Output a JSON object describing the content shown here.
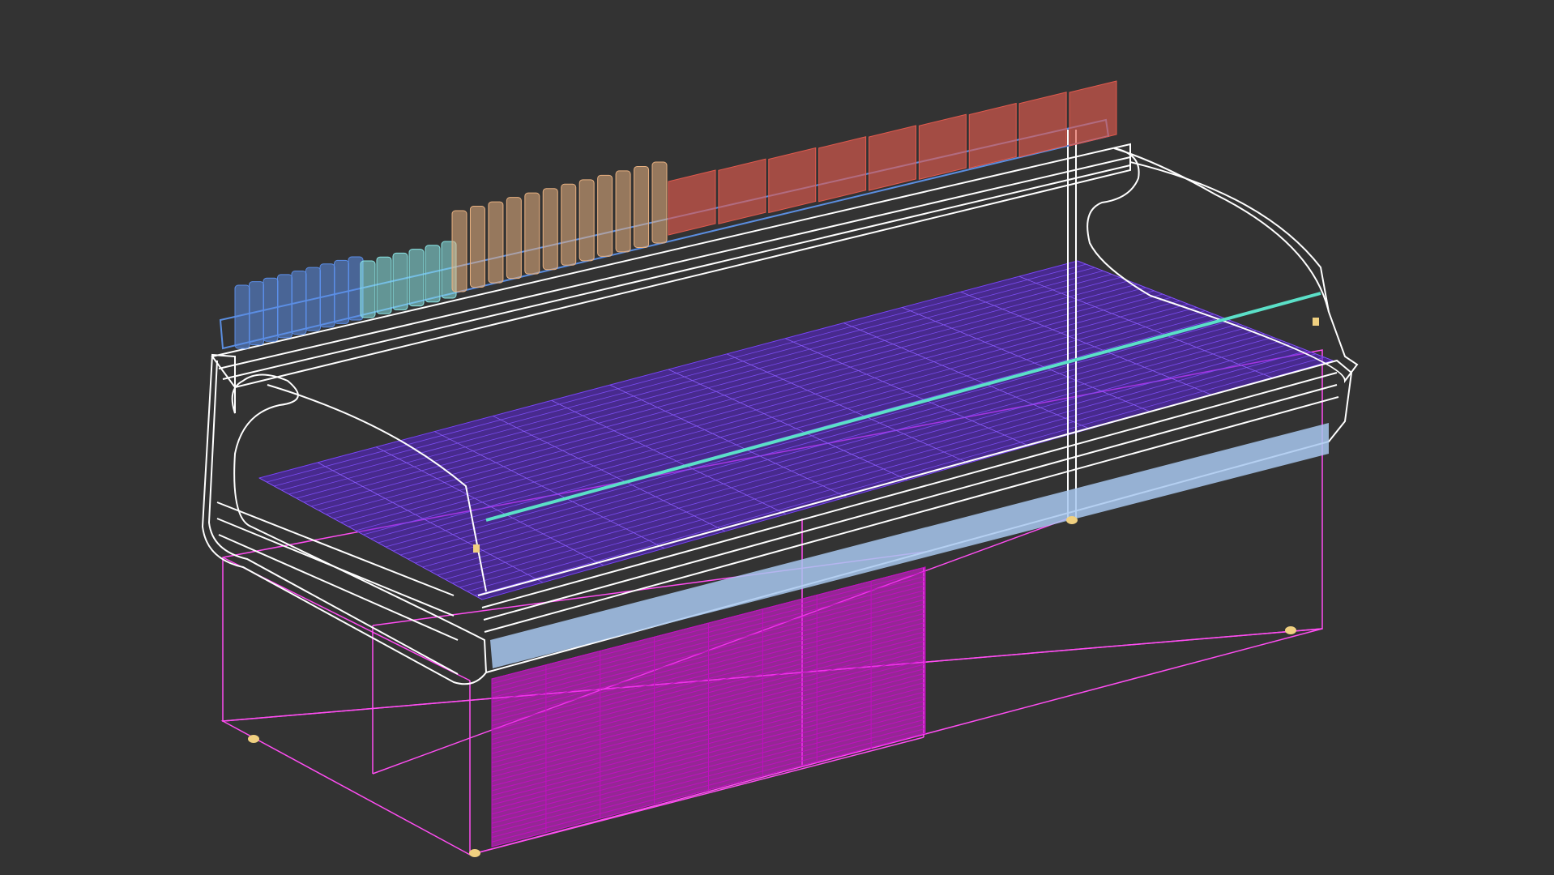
{
  "viewport": {
    "background": "#333333",
    "view_type": "wireframe perspective"
  },
  "model": {
    "name": "refrigerated-display-counter",
    "colors": {
      "case_outline": "#ffffff",
      "base_frame": "#ff4df2",
      "vent_panel": "#e61ee6",
      "deck_products": "#5a22d8",
      "front_rail_light": "#5be0c8",
      "front_bumper": "#a8c8f0",
      "shelf_tray": "#5b8ee0",
      "bottles_blue": "#5b8ee8",
      "bottles_cyan": "#8ae6e6",
      "bottles_peach": "#e8b080",
      "baskets_red": "#e05a4e",
      "feet": "#f0d080"
    }
  }
}
